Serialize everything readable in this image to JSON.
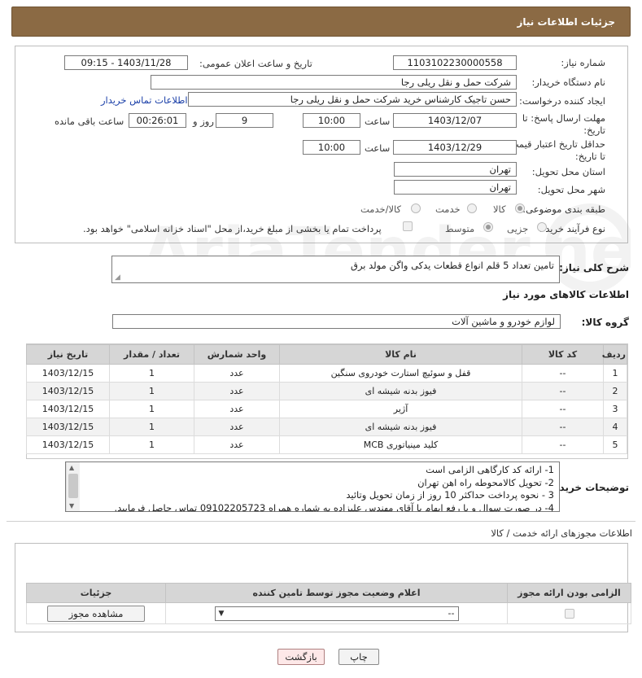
{
  "header": {
    "title": "جزئیات اطلاعات نیاز"
  },
  "form": {
    "need_number_label": "شماره نیاز:",
    "need_number": "1103102230000558",
    "announce_label": "تاریخ و ساعت اعلان عمومی:",
    "announce_value": "1403/11/28 - 09:15",
    "buyer_org_label": "نام دستگاه خریدار:",
    "buyer_org": "شرکت حمل و نقل ریلی رجا",
    "requester_label": "ایجاد کننده درخواست:",
    "requester": "حسن تاجیک کارشناس خرید شرکت حمل و نقل ریلی رجا",
    "buyer_contact_link": "اطلاعات تماس خریدار",
    "deadline_label": "مهلت ارسال پاسخ: تا تاریخ:",
    "deadline_date": "1403/12/07",
    "time_label": "ساعت",
    "deadline_time": "10:00",
    "days_value": "9",
    "days_label": "روز و",
    "remaining_time": "00:26:01",
    "remaining_label": "ساعت باقی مانده",
    "price_validity_label": "حداقل تاریخ اعتبار قیمت: تا تاریخ:",
    "price_validity_date": "1403/12/29",
    "price_validity_time": "10:00",
    "province_label": "استان محل تحویل:",
    "province": "تهران",
    "city_label": "شهر محل تحویل:",
    "city": "تهران",
    "category_label": "طبقه بندی موضوعی:",
    "category_options": [
      "کالا",
      "خدمت",
      "کالا/خدمت"
    ],
    "process_label": "نوع فرآیند خرید :",
    "process_options": [
      "جزیی",
      "متوسط"
    ],
    "payment_note": "پرداخت تمام یا بخشی از مبلغ خرید،از محل \"اسناد خزانه اسلامی\" خواهد بود."
  },
  "summary": {
    "label": "شرح کلی نیاز:",
    "text": "تامین تعداد 5 قلم انواع قطعات یدکی واگن مولد برق"
  },
  "goods": {
    "section_title": "اطلاعات کالاهای مورد نیاز",
    "group_label": "گروه کالا:",
    "group_value": "لوازم خودرو و ماشین آلات",
    "columns": [
      "ردیف",
      "کد کالا",
      "نام کالا",
      "واحد شمارش",
      "تعداد / مقدار",
      "تاریخ نیاز"
    ],
    "rows": [
      {
        "row": "1",
        "code": "--",
        "name": "قفل و سوئیچ استارت خودروی سنگین",
        "unit": "عدد",
        "qty": "1",
        "date": "1403/12/15"
      },
      {
        "row": "2",
        "code": "--",
        "name": "فیوز بدنه شیشه ای",
        "unit": "عدد",
        "qty": "1",
        "date": "1403/12/15"
      },
      {
        "row": "3",
        "code": "--",
        "name": "آژیر",
        "unit": "عدد",
        "qty": "1",
        "date": "1403/12/15"
      },
      {
        "row": "4",
        "code": "--",
        "name": "فیوز بدنه شیشه ای",
        "unit": "عدد",
        "qty": "1",
        "date": "1403/12/15"
      },
      {
        "row": "5",
        "code": "--",
        "name": "کلید مینیاتوری MCB",
        "unit": "عدد",
        "qty": "1",
        "date": "1403/12/15"
      }
    ]
  },
  "buyer_notes": {
    "label": "توضیحات خریدار:",
    "lines": [
      "1- ارائه کد کارگاهی الزامی است",
      "2- تحویل کالامحوطه راه اهن تهران",
      "3 - نحوه پرداخت حداکثر 10 روز از زمان تحویل وتائید",
      "4- در صورت سوال و یا رفع ابهام با آقای مهندس علیزاده به شماره همراه 09102205723 تماس حاصل فرمایید."
    ]
  },
  "licenses": {
    "section_title": "اطلاعات مجوزهای ارائه خدمت / کالا",
    "columns": [
      "الزامی بودن ارائه مجوز",
      "اعلام وضعیت مجوز توسط تامین کننده",
      "جزئیات"
    ],
    "select_value": "--",
    "view_button": "مشاهده مجوز"
  },
  "footer": {
    "print_button": "چاپ",
    "back_button": "بازگشت"
  },
  "watermark": {
    "text": "AriaTender.neT"
  }
}
